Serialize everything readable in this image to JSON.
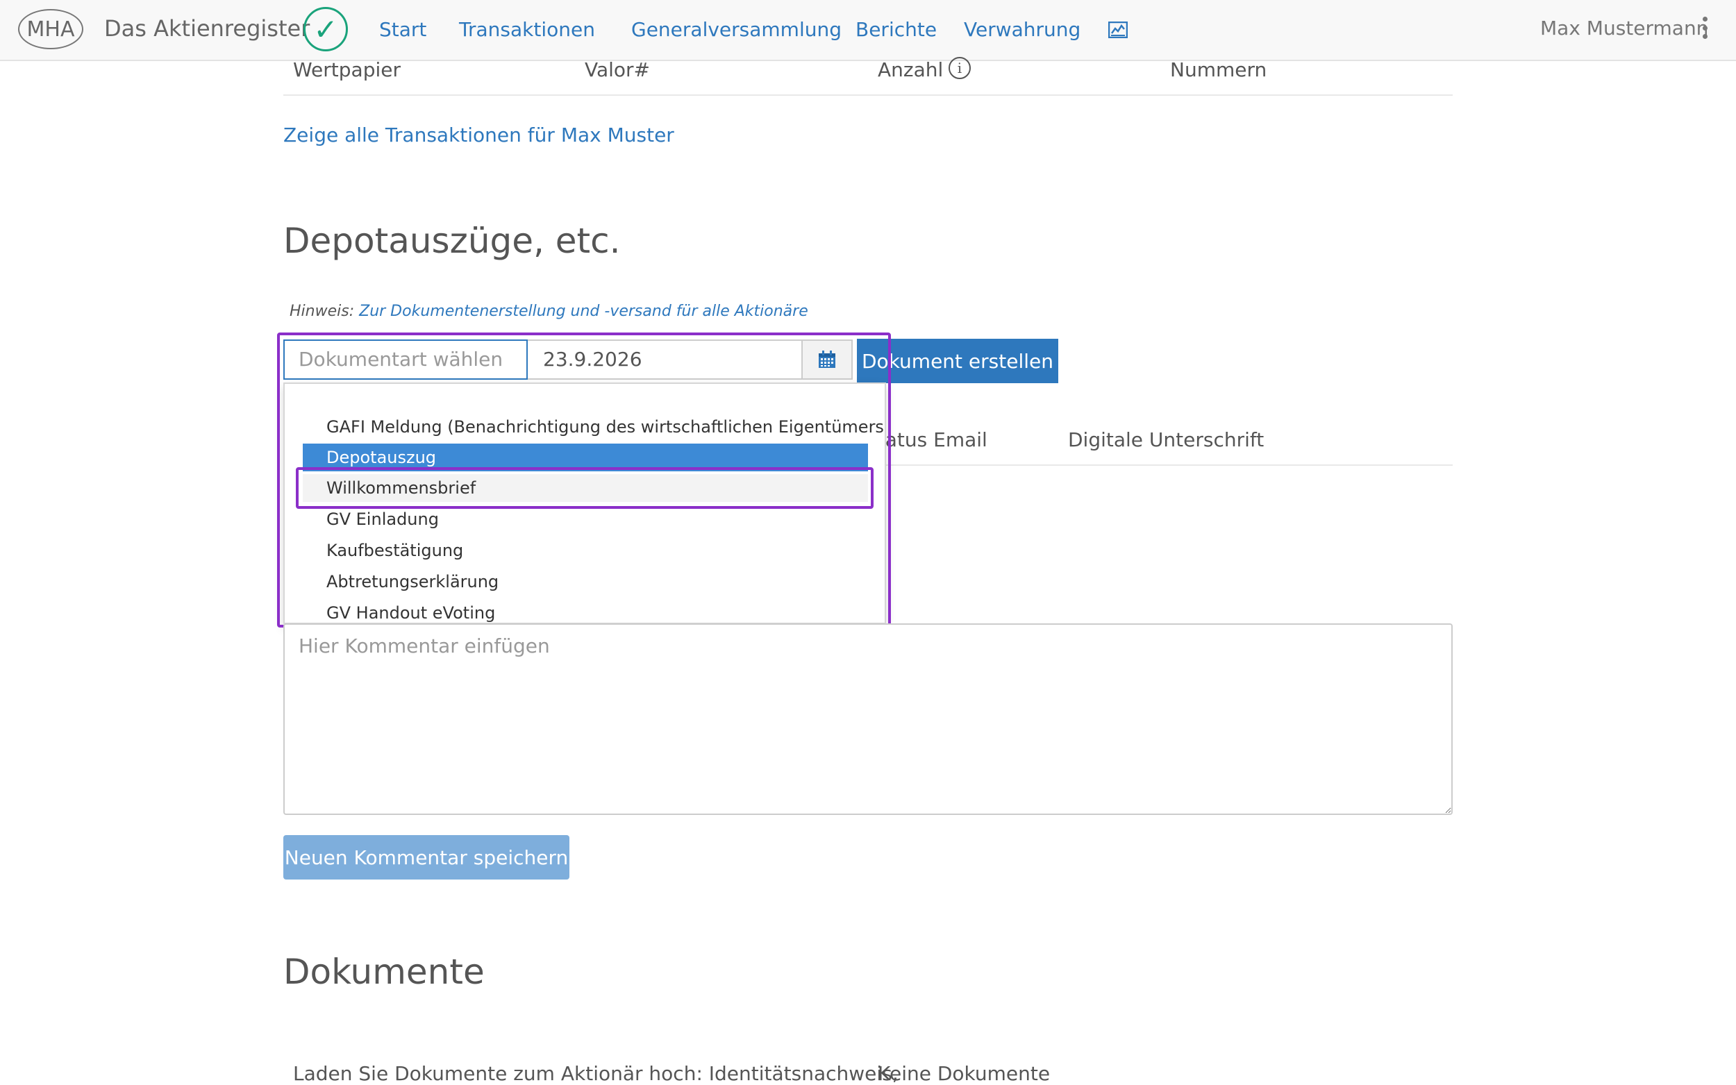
{
  "header": {
    "logo_text": "MHA",
    "brand": "Das Aktienregister",
    "nav": [
      {
        "label": "Start"
      },
      {
        "label": "Transaktionen"
      },
      {
        "label": "Generalversammlung"
      },
      {
        "label": "Berichte"
      },
      {
        "label": "Verwahrung"
      }
    ],
    "user_name": "Max Mustermann"
  },
  "securities_table": {
    "headers": [
      "Wertpapier",
      "Valor#",
      "Anzahl",
      "Nummern"
    ]
  },
  "transactions_link": "Zeige alle Transaktionen für Max Muster",
  "documents_section": {
    "title": "Depotauszüge, etc.",
    "hint_label": "Hinweis:",
    "hint_link": "Zur Dokumentenerstellung und -versand für alle Aktionäre",
    "select_placeholder": "Dokumentart wählen",
    "date_value": "23.9.2026",
    "create_button": "Dokument erstellen",
    "table_headers": [
      "Status Email",
      "Digitale Unterschrift"
    ],
    "dropdown_options": [
      {
        "label": "GAFI Meldung (Benachrichtigung des wirtschaftlichen Eigentümers)"
      },
      {
        "label": "Depotauszug",
        "state": "selected"
      },
      {
        "label": "Willkommensbrief",
        "state": "hover"
      },
      {
        "label": "GV Einladung"
      },
      {
        "label": "Kaufbestätigung"
      },
      {
        "label": "Abtretungserklärung"
      },
      {
        "label": "GV Handout eVoting"
      }
    ]
  },
  "comment": {
    "placeholder": "Hier Kommentar einfügen",
    "save_button": "Neuen Kommentar speichern"
  },
  "dokumente": {
    "title": "Dokumente",
    "upload_text": "Laden Sie Dokumente zum Aktionär hoch: Identitätsnachweis,",
    "empty_text": "Keine Dokumente"
  },
  "colors": {
    "link": "#2e78bd",
    "primary_button": "#2e78bd",
    "selected_option": "#3d8ad6",
    "highlight": "#8b2fc9",
    "check": "#1aa37b"
  }
}
